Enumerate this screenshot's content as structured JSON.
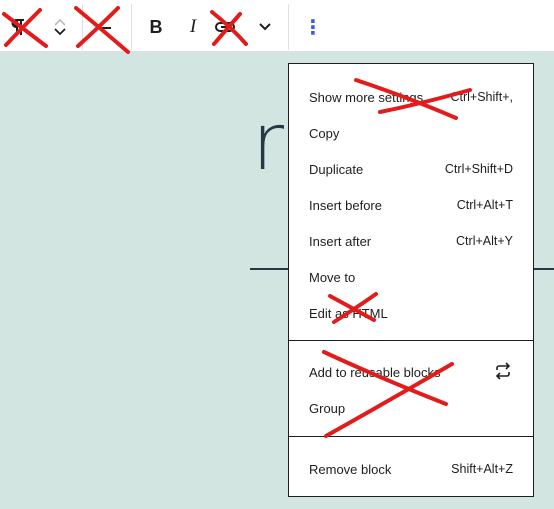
{
  "toolbar": {
    "bold_label": "B",
    "italic_label": "I",
    "options_label": "⋮",
    "paragraph_icon": "paragraph-icon",
    "mover_icon": "chevron-updown-icon",
    "align_icon": "align-icon",
    "link_icon": "link-icon",
    "more_rich_text_icon": "chevron-down-icon"
  },
  "canvas": {
    "heading_fragment": "r",
    "background": "#d3e5e0"
  },
  "menu": {
    "items": [
      {
        "label": "Show more settings",
        "shortcut": "Ctrl+Shift+,"
      },
      {
        "label": "Copy",
        "shortcut": ""
      },
      {
        "label": "Duplicate",
        "shortcut": "Ctrl+Shift+D"
      },
      {
        "label": "Insert before",
        "shortcut": "Ctrl+Alt+T"
      },
      {
        "label": "Insert after",
        "shortcut": "Ctrl+Alt+Y"
      },
      {
        "label": "Move to",
        "shortcut": ""
      },
      {
        "label": "Edit as HTML",
        "shortcut": ""
      },
      {
        "label": "Add to reusable blocks",
        "shortcut": ""
      },
      {
        "label": "Group",
        "shortcut": ""
      },
      {
        "label": "Remove block",
        "shortcut": "Shift+Alt+Z"
      }
    ],
    "reusable_icon": "convert-icon"
  },
  "colors": {
    "accent": "#3858e9",
    "scribble": "#e21b1b",
    "text": "#1e1e1e"
  }
}
